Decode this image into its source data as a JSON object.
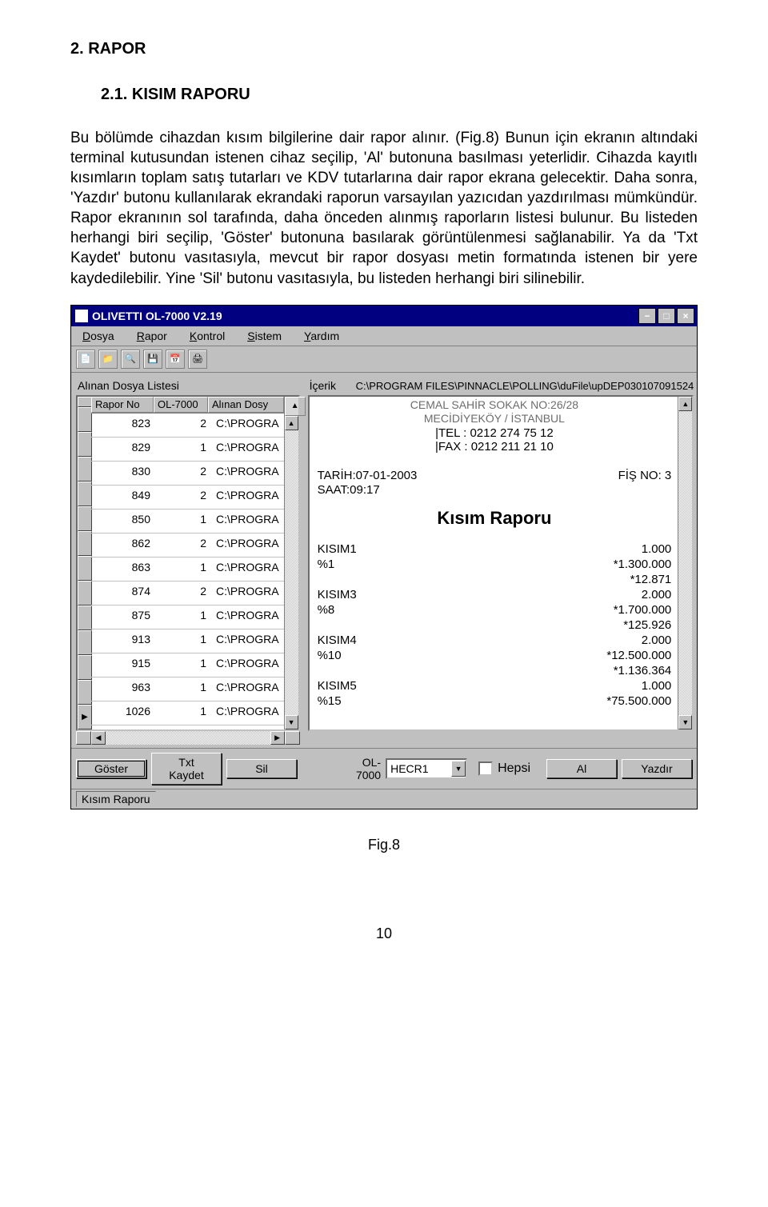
{
  "doc": {
    "h1": "2. RAPOR",
    "h2": "2.1.   KISIM RAPORU",
    "para": "Bu bölümde cihazdan kısım bilgilerine dair rapor alınır. (Fig.8) Bunun için ekranın altındaki terminal kutusundan istenen cihaz seçilip, 'Al' butonuna basılması yeterlidir. Cihazda kayıtlı kısımların toplam satış tutarları ve KDV tutarlarına dair rapor ekrana gelecektir. Daha sonra,  'Yazdır' butonu kullanılarak ekrandaki raporun varsayılan yazıcıdan yazdırılması mümkündür. Rapor ekranının sol tarafında, daha önceden alınmış raporların listesi bulunur. Bu listeden herhangi biri seçilip, 'Göster' butonuna basılarak görüntülenmesi sağlanabilir. Ya da 'Txt Kaydet' butonu vasıtasıyla, mevcut bir rapor dosyası metin formatında istenen bir yere kaydedilebilir. Yine 'Sil' butonu vasıtasıyla, bu listeden herhangi biri silinebilir.",
    "figcap": "Fig.8",
    "pgnum": "10"
  },
  "win": {
    "title": "OLIVETTI OL-7000 V2.19",
    "menus": {
      "m0": "Dosya",
      "m1": "Rapor",
      "m2": "Kontrol",
      "m3": "Sistem",
      "m4": "Yardım"
    },
    "leftlabel": "Alınan Dosya Listesi",
    "hdr": {
      "c0": "Rapor No",
      "c1": "OL-7000",
      "c2": "Alınan Dosy"
    },
    "rows": [
      {
        "a": "823",
        "b": "2",
        "c": "C:\\PROGRA"
      },
      {
        "a": "829",
        "b": "1",
        "c": "C:\\PROGRA"
      },
      {
        "a": "830",
        "b": "2",
        "c": "C:\\PROGRA"
      },
      {
        "a": "849",
        "b": "2",
        "c": "C:\\PROGRA"
      },
      {
        "a": "850",
        "b": "1",
        "c": "C:\\PROGRA"
      },
      {
        "a": "862",
        "b": "2",
        "c": "C:\\PROGRA"
      },
      {
        "a": "863",
        "b": "1",
        "c": "C:\\PROGRA"
      },
      {
        "a": "874",
        "b": "2",
        "c": "C:\\PROGRA"
      },
      {
        "a": "875",
        "b": "1",
        "c": "C:\\PROGRA"
      },
      {
        "a": "913",
        "b": "1",
        "c": "C:\\PROGRA"
      },
      {
        "a": "915",
        "b": "1",
        "c": "C:\\PROGRA"
      },
      {
        "a": "963",
        "b": "1",
        "c": "C:\\PROGRA"
      },
      {
        "a": "1026",
        "b": "1",
        "c": "C:\\PROGRA"
      }
    ],
    "right": {
      "label": "İçerik",
      "path": "C:\\PROGRAM FILES\\PINNACLE\\POLLING\\duFile\\upDEP030107091524",
      "gray1": "CEMAL SAHİR SOKAK  NO:26/28",
      "gray2": "MECİDİYEKÖY / İSTANBUL",
      "tel": "|TEL : 0212 274 75 12",
      "fax": "|FAX : 0212 211 21 10",
      "tarih": "TARİH:07-01-2003",
      "fis": "FİŞ NO:  3",
      "saat": "SAAT:09:17",
      "title": "Kısım Raporu",
      "lines": [
        {
          "l": "KISIM1",
          "r": "1.000"
        },
        {
          "l": "%1",
          "r": "*1.300.000"
        },
        {
          "l": "",
          "r": "*12.871"
        },
        {
          "l": "KISIM3",
          "r": "2.000"
        },
        {
          "l": "%8",
          "r": "*1.700.000"
        },
        {
          "l": "",
          "r": "*125.926"
        },
        {
          "l": "KISIM4",
          "r": "2.000"
        },
        {
          "l": "%10",
          "r": "*12.500.000"
        },
        {
          "l": "",
          "r": "*1.136.364"
        },
        {
          "l": "KISIM5",
          "r": "1.000"
        },
        {
          "l": "%15",
          "r": "*75.500.000"
        }
      ]
    },
    "btns": {
      "goster": "Göster",
      "txt": "Txt Kaydet",
      "sil": "Sil",
      "model": "OL-7000",
      "combo": "HECR1",
      "hepsi": "Hepsi",
      "al": "Al",
      "yazdir": "Yazdır"
    },
    "status": "Kısım Raporu"
  }
}
